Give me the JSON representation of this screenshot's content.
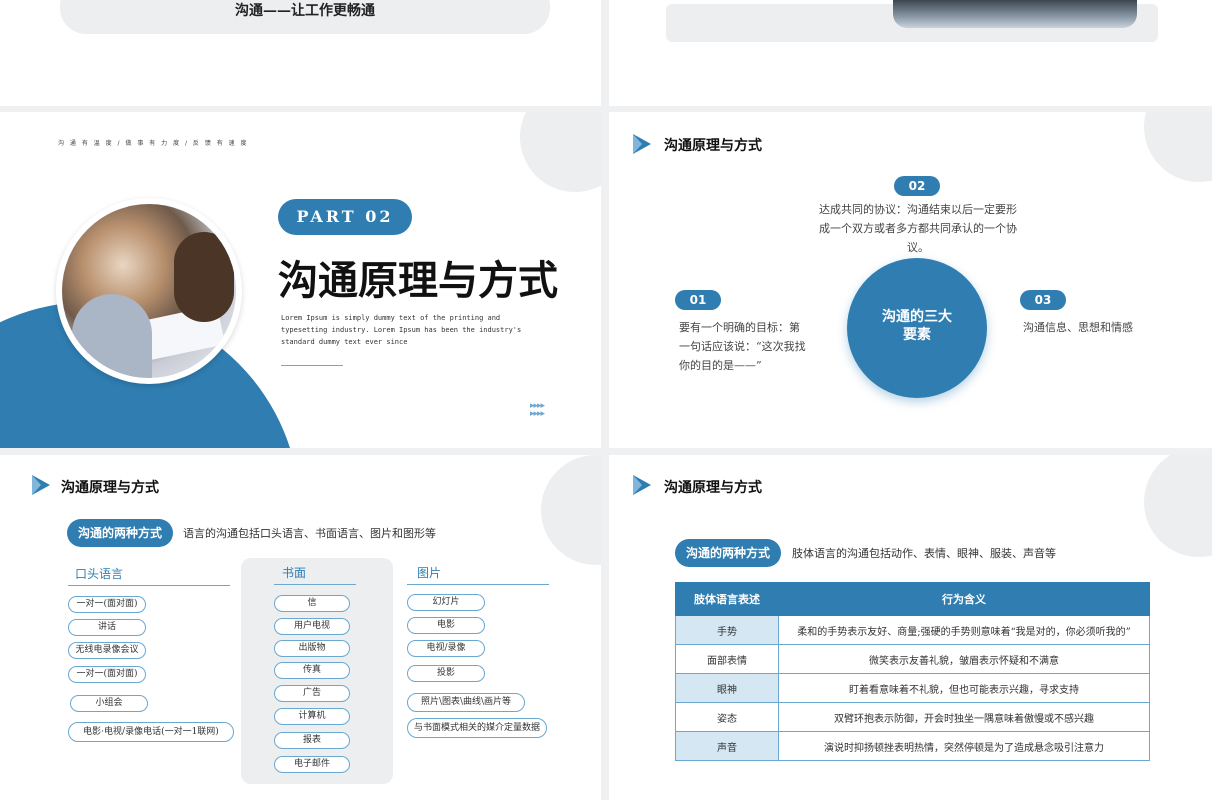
{
  "slide1": {
    "tagline": "沟通——让工作更畅通"
  },
  "slide3": {
    "breadcrumb": "沟 通 有 温 度 / 做 事 有 力 度 / 反 馈 有 速 度",
    "part": "PART 02",
    "title": "沟通原理与方式",
    "desc": "Lorem Ipsum is simply dummy text of the printing and typesetting industry. Lorem Ipsum has been the industry's standard dummy text ever since"
  },
  "slide4": {
    "title": "沟通原理与方式",
    "center": "沟通的三大要素",
    "items": [
      {
        "num": "01",
        "text": "要有一个明确的目标：第一句话应该说：“这次我找你的目的是——”"
      },
      {
        "num": "02",
        "text": "达成共同的协议：沟通结束以后一定要形成一个双方或者多方都共同承认的一个协议。"
      },
      {
        "num": "03",
        "text": "沟通信息、思想和情感"
      }
    ]
  },
  "slide5": {
    "title": "沟通原理与方式",
    "badge": "沟通的两种方式",
    "intro": "语言的沟通包括口头语言、书面语言、图片和图形等",
    "col_oral": {
      "heading": "口头语言",
      "items": [
        "一对一(面对面)",
        "讲话",
        "无线电录像会议",
        "一对一(面对面)",
        "小组会",
        "电影·电视/录像电话(一对一1联网)"
      ]
    },
    "col_written": {
      "heading": "书面",
      "items": [
        "信",
        "用户电视",
        "出版物",
        "传真",
        "广告",
        "计算机",
        "报表",
        "电子邮件"
      ]
    },
    "col_picture": {
      "heading": "图片",
      "items": [
        "幻灯片",
        "电影",
        "电视/录像",
        "投影",
        "照片\\图表\\曲线\\画片等",
        "与书面模式相关的媒介定量数据"
      ]
    }
  },
  "slide6": {
    "title": "沟通原理与方式",
    "badge": "沟通的两种方式",
    "intro": "肢体语言的沟通包括动作、表情、眼神、服装、声音等",
    "table": {
      "headers": [
        "肢体语言表述",
        "行为含义"
      ],
      "rows": [
        [
          "手势",
          "柔和的手势表示友好、商量;强硬的手势则意味着“我是对的，你必须听我的”"
        ],
        [
          "面部表情",
          "微笑表示友善礼貌，皱眉表示怀疑和不满意"
        ],
        [
          "眼神",
          "盯着看意味着不礼貌，但也可能表示兴趣，寻求支持"
        ],
        [
          "姿态",
          "双臂环抱表示防御，开会时独坐一隅意味着傲慢或不感兴趣"
        ],
        [
          "声音",
          "演说时抑扬顿挫表明热情，突然停顿是为了造成悬念吸引注意力"
        ]
      ]
    }
  },
  "colors": {
    "accent": "#2f7db1",
    "light_accent": "#d5e7f3",
    "gray": "#eceef0"
  }
}
